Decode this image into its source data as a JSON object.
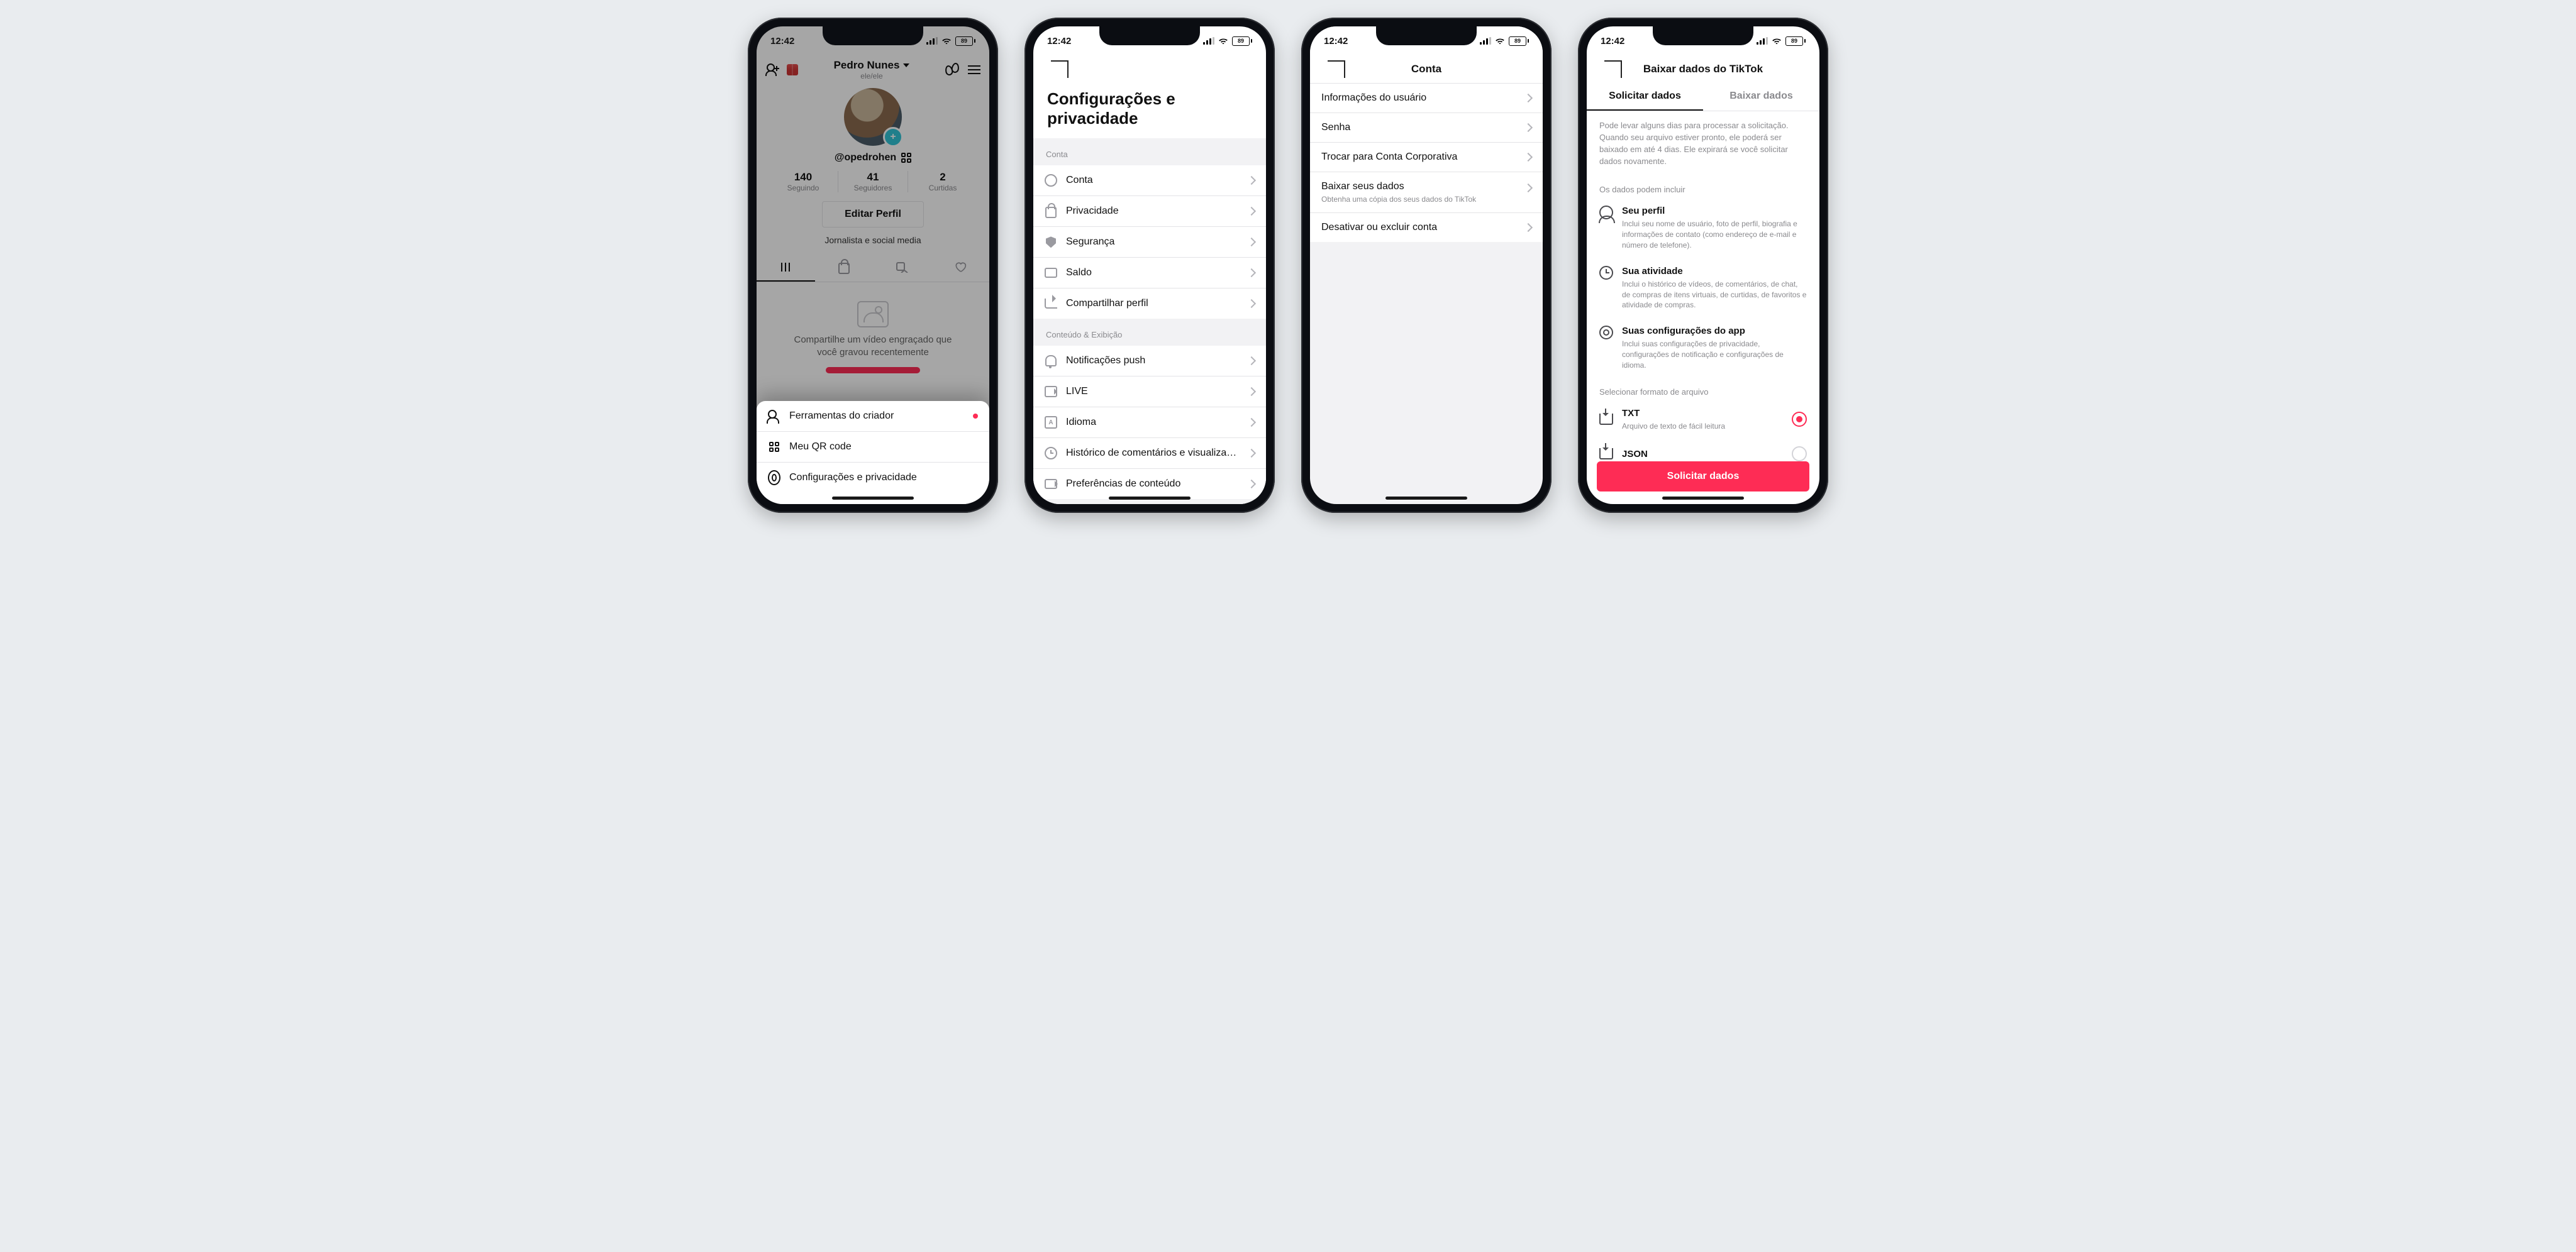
{
  "status": {
    "time": "12:42",
    "battery": "89"
  },
  "s1": {
    "topbar": {
      "name": "Pedro Nunes",
      "pronouns": "ele/ele"
    },
    "handle": "@opedrohen",
    "stats": {
      "following": {
        "num": "140",
        "cap": "Seguindo"
      },
      "followers": {
        "num": "41",
        "cap": "Seguidores"
      },
      "likes": {
        "num": "2",
        "cap": "Curtidas"
      }
    },
    "edit": "Editar Perfil",
    "bio": "Jornalista e social media",
    "empty": "Compartilhe um vídeo engraçado que você gravou recentemente",
    "sheet": {
      "creator": "Ferramentas do criador",
      "qr": "Meu QR code",
      "settings": "Configurações e privacidade"
    }
  },
  "s2": {
    "title": "Configurações e privacidade",
    "groups": {
      "account": "Conta",
      "content": "Conteúdo & Exibição"
    },
    "rows": {
      "account": "Conta",
      "privacy": "Privacidade",
      "security": "Segurança",
      "balance": "Saldo",
      "share": "Compartilhar perfil",
      "push": "Notificações push",
      "live": "LIVE",
      "lang": "Idioma",
      "history": "Histórico de comentários e visualiza…",
      "prefs": "Preferências de conteúdo"
    }
  },
  "s3": {
    "title": "Conta",
    "rows": {
      "userinfo": "Informações do usuário",
      "password": "Senha",
      "switchbiz": "Trocar para Conta Corporativa",
      "download": "Baixar seus dados",
      "download_sub": "Obtenha uma cópia dos seus dados do TikTok",
      "deactivate": "Desativar ou excluir conta"
    }
  },
  "s4": {
    "title": "Baixar dados do TikTok",
    "tabs": {
      "request": "Solicitar dados",
      "download": "Baixar dados"
    },
    "intro": "Pode levar alguns dias para processar a solicitação. Quando seu arquivo estiver pronto, ele poderá ser baixado em até 4 dias. Ele expirará se você solicitar dados novamente.",
    "include_h": "Os dados podem incluir",
    "profile_t": "Seu perfil",
    "profile_d": "Inclui seu nome de usuário, foto de perfil, biografia e informações de contato (como endereço de e-mail e número de telefone).",
    "activity_t": "Sua atividade",
    "activity_d": "Inclui o histórico de vídeos, de comentários, de chat, de compras de itens virtuais, de curtidas, de favoritos e atividade de compras.",
    "settings_t": "Suas configurações do app",
    "settings_d": "Inclui suas configurações de privacidade, configurações de notificação e configurações de idioma.",
    "format_h": "Selecionar formato de arquivo",
    "txt_t": "TXT",
    "txt_d": "Arquivo de texto de fácil leitura",
    "json_t": "JSON",
    "cta": "Solicitar dados"
  }
}
